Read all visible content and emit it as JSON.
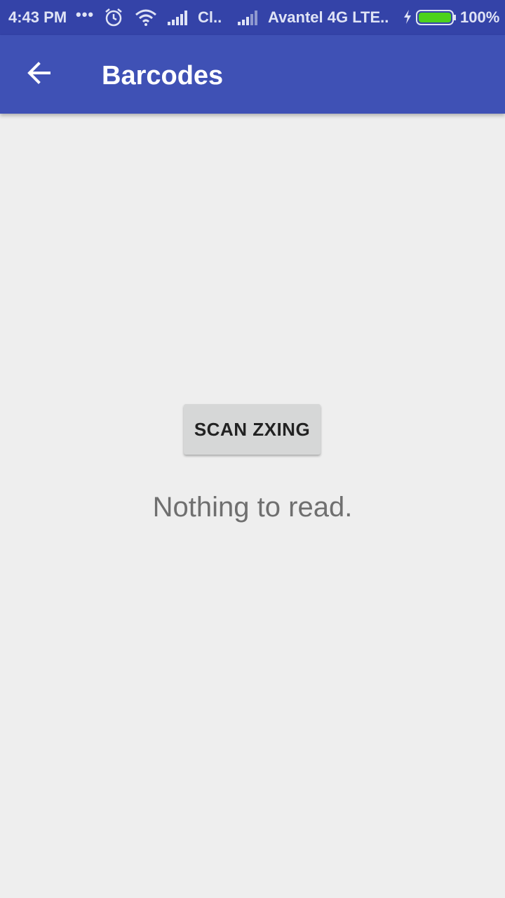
{
  "status_bar": {
    "time": "4:43 PM",
    "more": "•••",
    "alarm_icon": "alarm-clock-icon",
    "wifi_icon": "wifi-icon",
    "carrier1": "Cl..",
    "carrier2": "Avantel 4G LTE..",
    "battery_percent": "100%",
    "battery_color": "#4cd21c"
  },
  "app_bar": {
    "title": "Barcodes",
    "back_icon": "arrow-back-icon",
    "color": "#3f51b5"
  },
  "main": {
    "scan_button_label": "SCAN ZXING",
    "result_text": "Nothing to read."
  }
}
